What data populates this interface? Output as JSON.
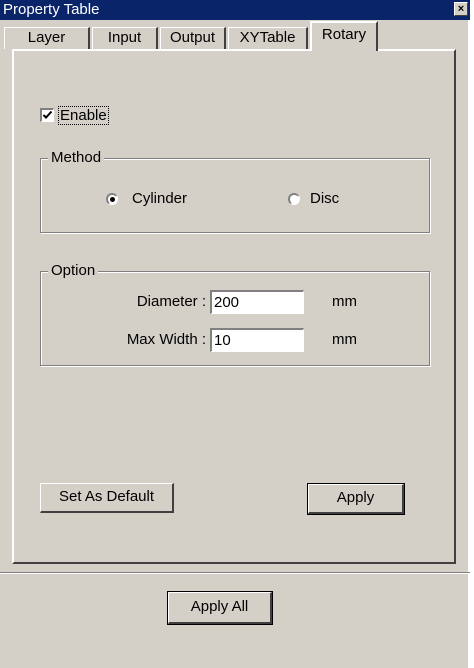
{
  "window": {
    "title": "Property Table",
    "close_glyph": "×"
  },
  "tabs": [
    {
      "label": "Layer"
    },
    {
      "label": "Input"
    },
    {
      "label": "Output"
    },
    {
      "label": "XYTable"
    },
    {
      "label": "Rotary",
      "active": true
    }
  ],
  "enable": {
    "label": "Enable",
    "checked": true
  },
  "method": {
    "title": "Method",
    "options": [
      {
        "label": "Cylinder",
        "selected": true
      },
      {
        "label": "Disc",
        "selected": false
      }
    ]
  },
  "option": {
    "title": "Option",
    "diameter": {
      "label": "Diameter :",
      "value": "200",
      "unit": "mm"
    },
    "max_width": {
      "label": "Max Width :",
      "value": "10",
      "unit": "mm"
    }
  },
  "buttons": {
    "set_default": "Set As Default",
    "apply": "Apply",
    "apply_all": "Apply All"
  },
  "icons": {
    "close": "close-icon",
    "check": "check-icon"
  },
  "colors": {
    "title_bar": "#0a246a",
    "face": "#d4d0c8"
  }
}
